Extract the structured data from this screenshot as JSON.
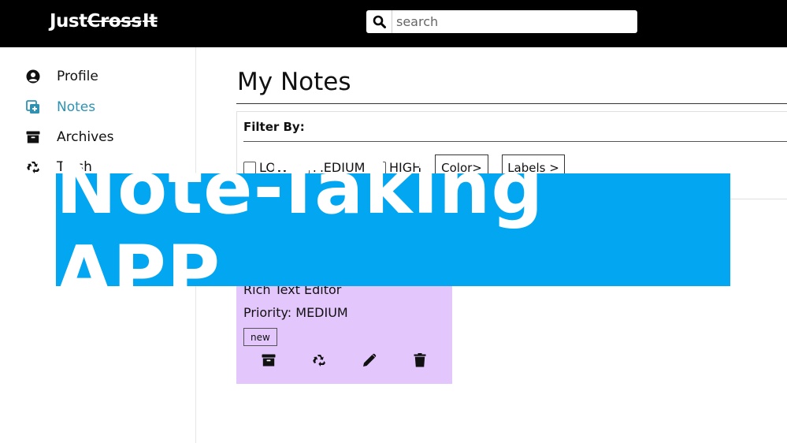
{
  "header": {
    "logo_part1": "Just",
    "logo_part2": "Cross",
    "logo_part3": "It",
    "search_placeholder": "search",
    "search_icon": "magnifier-icon"
  },
  "sidebar": {
    "items": [
      {
        "label": "Profile",
        "icon": "user-circle-icon",
        "active": false
      },
      {
        "label": "Notes",
        "icon": "add-note-icon",
        "active": true
      },
      {
        "label": "Archives",
        "icon": "archive-box-icon",
        "active": false
      },
      {
        "label": "Trash",
        "icon": "recycle-icon",
        "active": false
      }
    ]
  },
  "main": {
    "title": "My Notes",
    "filter": {
      "label": "Filter By:",
      "priorities": [
        "LOW",
        "MEDIUM",
        "HIGH"
      ],
      "color_button": "Color>",
      "labels_button": "Labels >"
    },
    "note": {
      "title": "Rich Text Editor",
      "priority": "Priority: MEDIUM",
      "tag": "new",
      "background": "#e3c7fc",
      "actions": [
        "archive-icon",
        "recycle-icon",
        "pencil-icon",
        "trash-icon"
      ]
    }
  },
  "banner": {
    "text": "Note-Taking APP",
    "color": "#03a6f0"
  },
  "colors": {
    "accent": "#2e93b2",
    "topbar": "#000000"
  }
}
